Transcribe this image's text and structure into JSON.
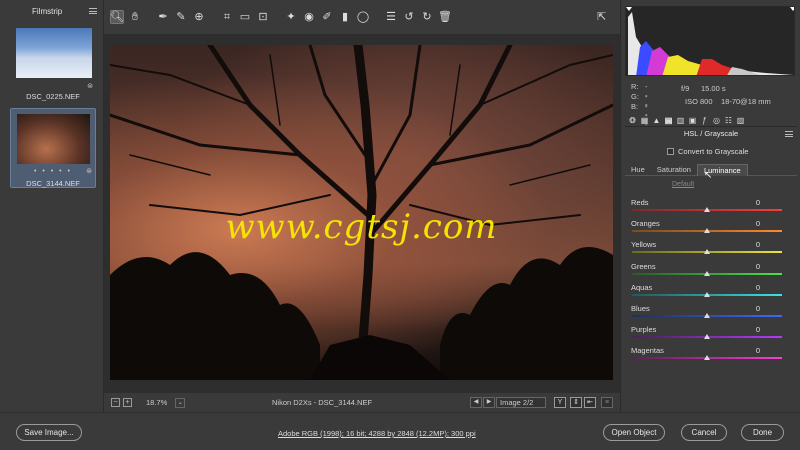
{
  "filmstrip": {
    "title": "Filmstrip",
    "items": [
      {
        "name": "DSC_0225.NEF"
      },
      {
        "name": "DSC_3144.NEF",
        "rating": "• • • • •"
      }
    ]
  },
  "toolbar": {
    "tools": [
      "zoom-icon",
      "hand-icon",
      "white-balance-icon",
      "color-sampler-icon",
      "target-adjust-icon",
      "crop-icon",
      "straighten-icon",
      "transform-icon",
      "spot-removal-icon",
      "red-eye-icon",
      "adjustment-brush-icon",
      "graduated-filter-icon",
      "radial-filter-icon",
      "preferences-icon",
      "rotate-ccw-icon",
      "rotate-cw-icon",
      "trash-icon"
    ]
  },
  "preview": {
    "watermark": "www.cgtsj.com",
    "zoom_level": "18.7%",
    "camera": "Nikon D2Xs  -  DSC_3144.NEF",
    "image_count": "Image 2/2",
    "view_mode_label": "Y"
  },
  "readout": {
    "r_label": "R:",
    "r_value": "---",
    "g_label": "G:",
    "g_value": "---",
    "b_label": "B:",
    "b_value": "---",
    "aperture": "f/9",
    "shutter": "15.00 s",
    "iso": "ISO 800",
    "lens": "18-70@18 mm"
  },
  "panel": {
    "title": "HSL / Grayscale",
    "grayscale_label": "Convert to Grayscale",
    "tabs": [
      "Hue",
      "Saturation",
      "Luminance"
    ],
    "active_tab": "Luminance",
    "default_label": "Default",
    "sliders": [
      {
        "label": "Reds",
        "value": "0",
        "gradient": [
          "#7a2a2a",
          "#ff3a3a"
        ]
      },
      {
        "label": "Oranges",
        "value": "0",
        "gradient": [
          "#7a4a20",
          "#ff8a2a"
        ]
      },
      {
        "label": "Yellows",
        "value": "0",
        "gradient": [
          "#6a6a20",
          "#f2e23a"
        ]
      },
      {
        "label": "Greens",
        "value": "0",
        "gradient": [
          "#2a5a2a",
          "#4ae24a"
        ]
      },
      {
        "label": "Aquas",
        "value": "0",
        "gradient": [
          "#205a5a",
          "#3ae2e2"
        ]
      },
      {
        "label": "Blues",
        "value": "0",
        "gradient": [
          "#20305a",
          "#3a6aff"
        ]
      },
      {
        "label": "Purples",
        "value": "0",
        "gradient": [
          "#4a205a",
          "#b03aff"
        ]
      },
      {
        "label": "Magentas",
        "value": "0",
        "gradient": [
          "#5a2050",
          "#ff3ad8"
        ]
      }
    ]
  },
  "bottom": {
    "save_label": "Save Image...",
    "workflow": "Adobe RGB (1998); 16 bit; 4288 by 2848 (12.2MP); 300 ppi",
    "open_label": "Open Object",
    "cancel_label": "Cancel",
    "done_label": "Done"
  },
  "colors": {
    "background": "#3a3a3a",
    "watermark": "#f5e400",
    "selection": "#4f5d72"
  }
}
